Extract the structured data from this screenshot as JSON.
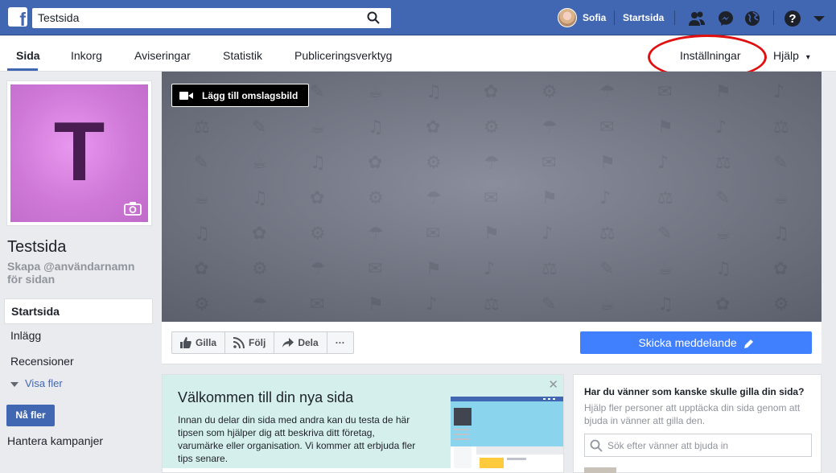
{
  "topbar": {
    "search_value": "Testsida",
    "user_name": "Sofia",
    "home_label": "Startsida",
    "icons": [
      "facebook-logo",
      "search-icon",
      "friend-requests-icon",
      "messenger-icon",
      "notifications-globe-icon",
      "help-icon",
      "account-menu-chevron-icon"
    ]
  },
  "pagenav": {
    "tabs": [
      {
        "label": "Sida",
        "active": true
      },
      {
        "label": "Inkorg"
      },
      {
        "label": "Aviseringar"
      },
      {
        "label": "Statistik"
      },
      {
        "label": "Publiceringsverktyg"
      }
    ],
    "settings_label": "Inställningar",
    "help_label": "Hjälp",
    "help_arrow": "▾"
  },
  "profile": {
    "initial": "T",
    "name": "Testsida",
    "username_prompt": "Skapa @användarnamn för sidan"
  },
  "leftnav": {
    "items": [
      {
        "label": "Startsida",
        "active": true
      },
      {
        "label": "Inlägg"
      },
      {
        "label": "Recensioner"
      }
    ],
    "more_label": "Visa fler",
    "promote_label": "Nå fler",
    "campaigns_label": "Hantera kampanjer"
  },
  "cover": {
    "add_cover_label": "Lägg till omslagsbild"
  },
  "actions": {
    "like_label": "Gilla",
    "follow_label": "Följ",
    "share_label": "Dela",
    "more_label": "···",
    "message_label": "Skicka meddelande"
  },
  "welcome": {
    "title": "Välkommen till din nya sida",
    "body": "Innan du delar din sida med andra kan du testa de här tipsen som hjälper dig att beskriva ditt företag, varumärke eller organisation. Vi kommer att erbjuda fler tips senare.",
    "close": "✕"
  },
  "invite": {
    "title": "Har du vänner som kanske skulle gilla din sida?",
    "body": "Hjälp fler personer att upptäcka din sida genom att bjuda in vänner att gilla den.",
    "search_placeholder": "Sök efter vänner att bjuda in"
  },
  "colors": {
    "brand_blue": "#4267b2",
    "send_blue": "#4080ff",
    "annotation_red": "#e01010"
  }
}
